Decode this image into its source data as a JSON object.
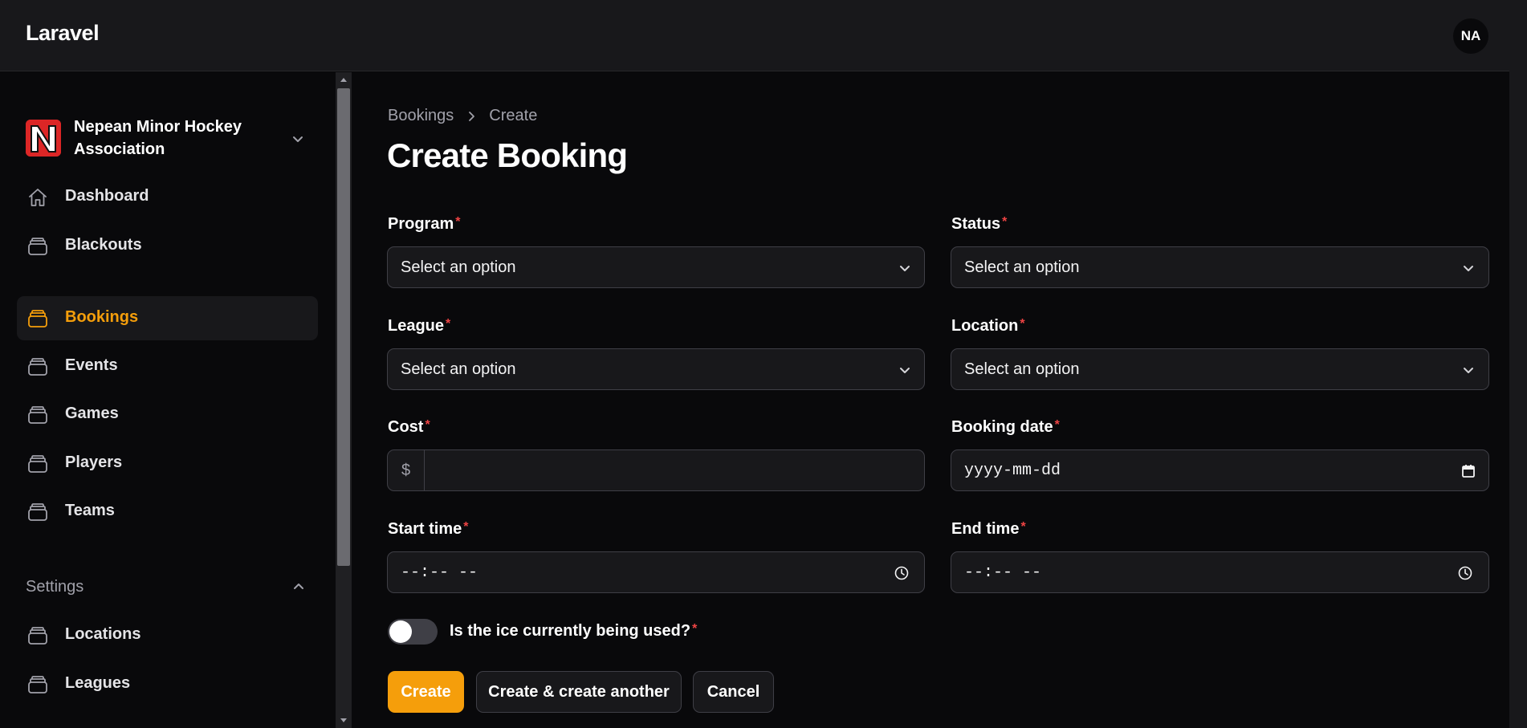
{
  "app": {
    "brand": "Laravel",
    "user_initials": "NA"
  },
  "tenant": {
    "name": "Nepean Minor Hockey Association"
  },
  "sidebar": {
    "items": [
      {
        "label": "Dashboard",
        "icon": "home-icon",
        "active": false
      },
      {
        "label": "Blackouts",
        "icon": "stack-icon",
        "active": false
      },
      {
        "label": "Bookings",
        "icon": "stack-icon",
        "active": true
      },
      {
        "label": "Events",
        "icon": "stack-icon",
        "active": false
      },
      {
        "label": "Games",
        "icon": "stack-icon",
        "active": false
      },
      {
        "label": "Players",
        "icon": "stack-icon",
        "active": false
      },
      {
        "label": "Teams",
        "icon": "stack-icon",
        "active": false
      }
    ],
    "settings_group": {
      "label": "Settings",
      "items": [
        {
          "label": "Locations",
          "icon": "stack-icon"
        },
        {
          "label": "Leagues",
          "icon": "stack-icon"
        }
      ]
    }
  },
  "breadcrumb": {
    "parent": "Bookings",
    "current": "Create"
  },
  "page": {
    "title": "Create Booking"
  },
  "form": {
    "program": {
      "label": "Program",
      "value": "Select an option"
    },
    "status": {
      "label": "Status",
      "value": "Select an option"
    },
    "league": {
      "label": "League",
      "value": "Select an option"
    },
    "location": {
      "label": "Location",
      "value": "Select an option"
    },
    "cost": {
      "label": "Cost",
      "prefix": "$",
      "value": ""
    },
    "booking_date": {
      "label": "Booking date",
      "placeholder": "yyyy-mm-dd"
    },
    "start_time": {
      "label": "Start time",
      "placeholder": "--:-- --"
    },
    "end_time": {
      "label": "End time",
      "placeholder": "--:-- --"
    },
    "ice_in_use": {
      "label": "Is the ice currently being used?",
      "checked": false
    },
    "required_mark": "*"
  },
  "actions": {
    "create": "Create",
    "create_another": "Create & create another",
    "cancel": "Cancel"
  },
  "colors": {
    "background": "#09090b",
    "surface": "#18181b",
    "accent": "#f59e0b",
    "required": "#ef4444"
  }
}
